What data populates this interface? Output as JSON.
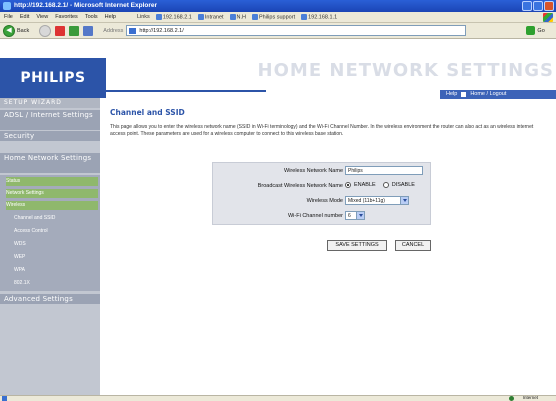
{
  "window": {
    "title": "http://192.168.2.1/ - Microsoft Internet Explorer"
  },
  "menubar": {
    "items": [
      "File",
      "Edit",
      "View",
      "Favorites",
      "Tools",
      "Help"
    ],
    "links_label": "Links",
    "links": [
      "192.168.2.1",
      "Intranet",
      "N.H",
      "Philips support",
      "192.168.1.1"
    ]
  },
  "toolbar": {
    "back_label": "Back",
    "address_label": "Address",
    "address_value": "http://192.168.2.1/",
    "go_label": "Go"
  },
  "header": {
    "brand": "PHILIPS",
    "title": "HOME NETWORK SETTINGS",
    "help_label": "Help",
    "home_logout_label": "Home / Logout"
  },
  "sidebar": {
    "wizard": "SETUP WIZARD",
    "adsl": "ADSL / Internet Settings",
    "security": "Security",
    "home_network": "Home Network Settings",
    "sub_items": [
      {
        "label": "Status",
        "level": 1
      },
      {
        "label": "Network Settings",
        "level": 1
      },
      {
        "label": "Wireless",
        "level": 1
      },
      {
        "label": "Channel and SSID",
        "level": 2
      },
      {
        "label": "Access Control",
        "level": 2
      },
      {
        "label": "WDS",
        "level": 2
      },
      {
        "label": "WEP",
        "level": 2
      },
      {
        "label": "WPA",
        "level": 2
      },
      {
        "label": "802.1X",
        "level": 2
      }
    ],
    "advanced": "Advanced Settings"
  },
  "main": {
    "section_title": "Channel and SSID",
    "intro": "This page allows you to enter the wireless network name (SSID in Wi-Fi terminology) and the Wi-Fi Channel Number. In the wireless environment the router can also act as an wireless internet access point. These parameters are used for a wireless computer to connect to this wireless base station.",
    "form": {
      "ssid_label": "Wireless Network Name",
      "ssid_value": "Philips",
      "broadcast_label": "Broadcast Wireless Network Name",
      "enable_label": "ENABLE",
      "disable_label": "DISABLE",
      "broadcast_selected": "ENABLE",
      "mode_label": "Wireless Mode",
      "mode_value": "Mixed (11b+11g)",
      "channel_label": "Wi-Fi Channel number",
      "channel_value": "6"
    },
    "save_label": "SAVE SETTINGS",
    "cancel_label": "CANCEL"
  },
  "statusbar": {
    "zone": "Internet"
  }
}
